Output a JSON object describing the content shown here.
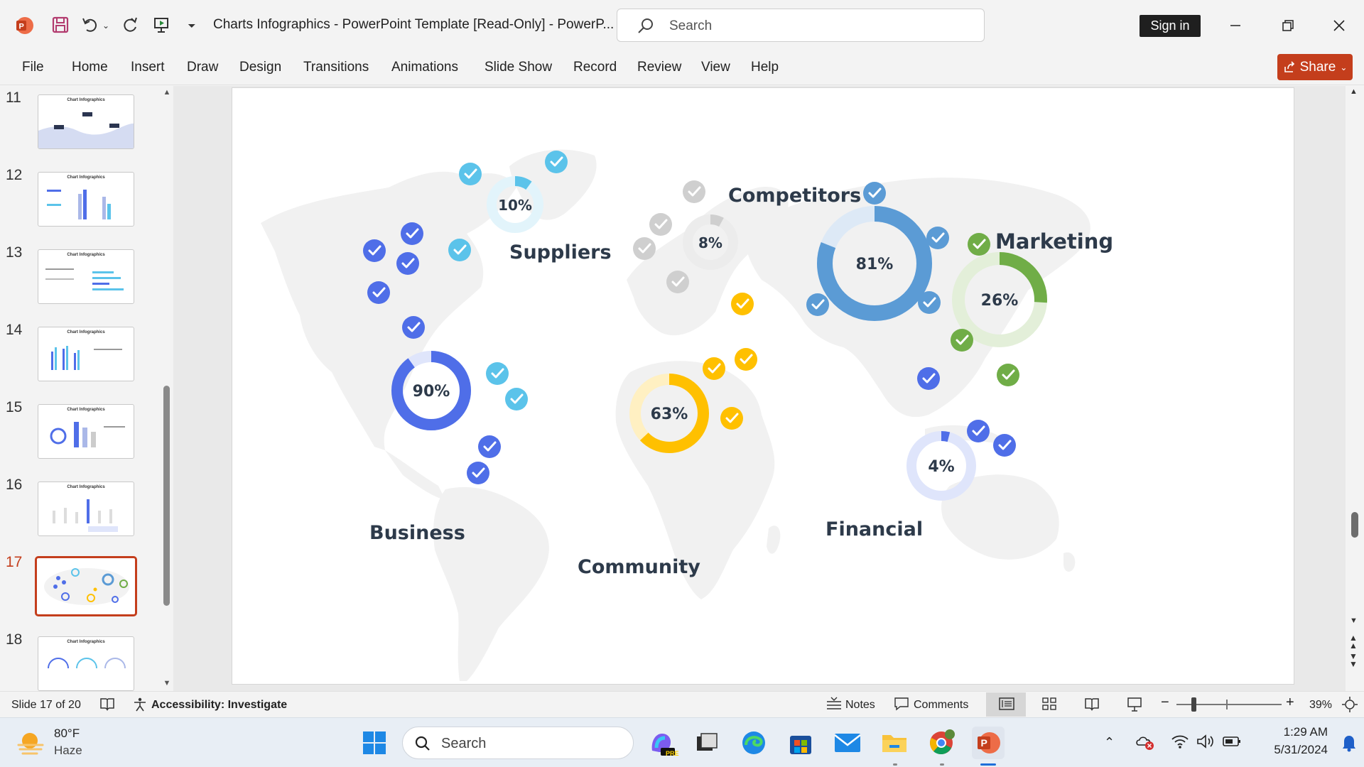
{
  "app": {
    "doc_title": "Charts Infographics - PowerPoint Template [Read-Only]  -  PowerP...",
    "search_placeholder": "Search",
    "sign_in": "Sign in",
    "share": "Share",
    "app_icon": "powerpoint-logo-icon"
  },
  "ribbon": {
    "tabs": [
      "File",
      "Home",
      "Insert",
      "Draw",
      "Design",
      "Transitions",
      "Animations",
      "Slide Show",
      "Record",
      "Review",
      "View",
      "Help"
    ]
  },
  "thumbnails": [
    {
      "num": "11",
      "title": "Chart Infographics"
    },
    {
      "num": "12",
      "title": "Chart Infographics"
    },
    {
      "num": "13",
      "title": "Chart Infographics"
    },
    {
      "num": "14",
      "title": "Chart Infographics"
    },
    {
      "num": "15",
      "title": "Chart Infographics"
    },
    {
      "num": "16",
      "title": "Chart Infographics"
    },
    {
      "num": "17",
      "title": "",
      "active": true
    },
    {
      "num": "18",
      "title": "Chart Infographics"
    }
  ],
  "slide": {
    "labels": {
      "suppliers": "Suppliers",
      "competitors": "Competitors",
      "marketing": "Marketing",
      "business": "Business",
      "community": "Community",
      "financial": "Financial"
    },
    "donuts": [
      {
        "key": "suppliers",
        "label": "10%",
        "value": 10,
        "color": "#5bc3ea",
        "track": "#e2f4fb"
      },
      {
        "key": "competitors",
        "label": "8%",
        "value": 8,
        "color": "#cfcfcf",
        "track": "#ececec"
      },
      {
        "key": "financial_big",
        "label": "81%",
        "value": 81,
        "color": "#5b9bd5",
        "track": "#dde9f6"
      },
      {
        "key": "marketing",
        "label": "26%",
        "value": 26,
        "color": "#70ad47",
        "track": "#e3efd9"
      },
      {
        "key": "business",
        "label": "90%",
        "value": 90,
        "color": "#4f6ee8",
        "track": "#dfe5fb"
      },
      {
        "key": "community",
        "label": "63%",
        "value": 63,
        "color": "#ffc000",
        "track": "#fff0c2"
      },
      {
        "key": "financial",
        "label": "4%",
        "value": 4,
        "color": "#4f6ee8",
        "track": "#dfe5fb"
      }
    ],
    "colors": {
      "blue": "#4f6ee8",
      "cyan": "#5bc3ea",
      "gray": "#cfcfcf",
      "steel": "#5b9bd5",
      "green": "#70ad47",
      "yellow": "#ffc000",
      "map": "#f0f0f0"
    }
  },
  "status": {
    "slide_of": "Slide 17 of 20",
    "accessibility": "Accessibility: Investigate",
    "notes": "Notes",
    "comments": "Comments",
    "zoom": "39%"
  },
  "taskbar": {
    "temp": "80°F",
    "weather": "Haze",
    "search": "Search",
    "time": "1:29 AM",
    "date": "5/31/2024",
    "copilot_badge": "PRE"
  }
}
